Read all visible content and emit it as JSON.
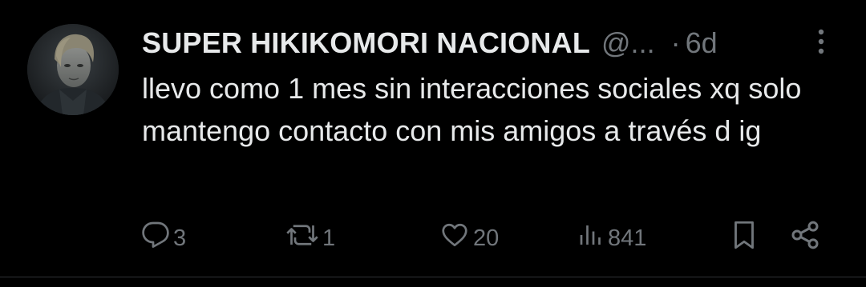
{
  "tweet": {
    "author_name": "SUPER HIKIKOMORI NACIONAL",
    "handle": "@...",
    "separator": "·",
    "time": "6d",
    "text": "llevo como 1 mes sin interacciones sociales xq solo mantengo contacto con mis amigos a través d ig"
  },
  "actions": {
    "replies": "3",
    "reposts": "1",
    "likes": "20",
    "views": "841"
  },
  "icons": {
    "reply": "reply-icon",
    "repost": "repost-icon",
    "like": "heart-icon",
    "views": "views-icon",
    "bookmark": "bookmark-icon",
    "share": "share-icon",
    "more": "more-vertical-icon"
  },
  "colors": {
    "background": "#000000",
    "primary_text": "#e7e9ea",
    "secondary_text": "#71767b",
    "divider": "#2f3336"
  }
}
